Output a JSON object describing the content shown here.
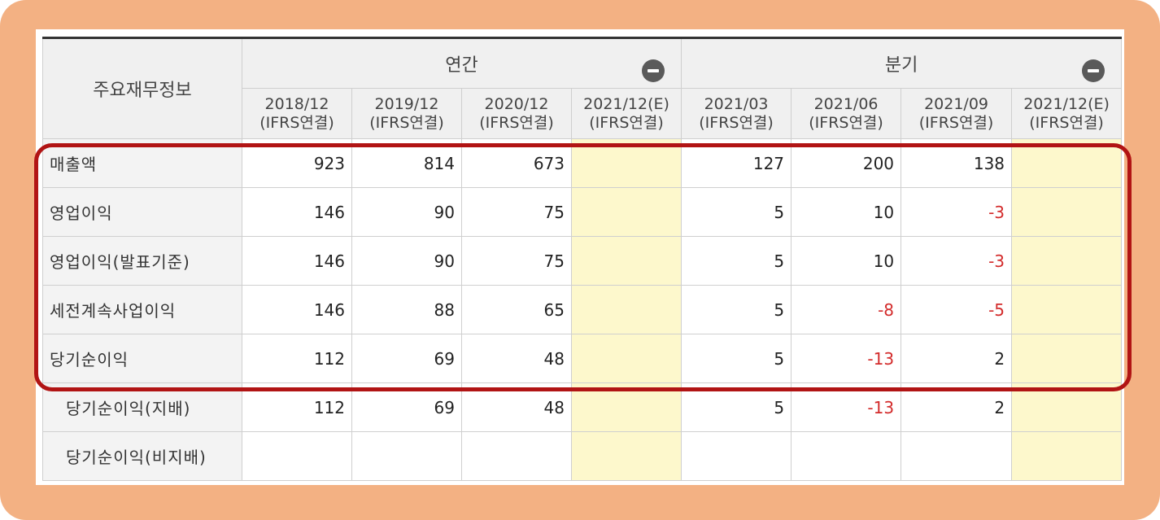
{
  "table": {
    "corner_label": "주요재무정보",
    "groups": [
      {
        "label": "연간",
        "toggle_icon": "minus-circle-icon"
      },
      {
        "label": "분기",
        "toggle_icon": "minus-circle-icon"
      }
    ],
    "periods": [
      {
        "date": "2018/12",
        "basis": "(IFRS연결)"
      },
      {
        "date": "2019/12",
        "basis": "(IFRS연결)"
      },
      {
        "date": "2020/12",
        "basis": "(IFRS연결)"
      },
      {
        "date": "2021/12(E)",
        "basis": "(IFRS연결)"
      },
      {
        "date": "2021/03",
        "basis": "(IFRS연결)"
      },
      {
        "date": "2021/06",
        "basis": "(IFRS연결)"
      },
      {
        "date": "2021/09",
        "basis": "(IFRS연결)"
      },
      {
        "date": "2021/12(E)",
        "basis": "(IFRS연결)"
      }
    ],
    "rows": [
      {
        "label": "매출액",
        "values": [
          "923",
          "814",
          "673",
          "",
          "127",
          "200",
          "138",
          ""
        ]
      },
      {
        "label": "영업이익",
        "values": [
          "146",
          "90",
          "75",
          "",
          "5",
          "10",
          "-3",
          ""
        ]
      },
      {
        "label": "영업이익(발표기준)",
        "values": [
          "146",
          "90",
          "75",
          "",
          "5",
          "10",
          "-3",
          ""
        ]
      },
      {
        "label": "세전계속사업이익",
        "values": [
          "146",
          "88",
          "65",
          "",
          "5",
          "-8",
          "-5",
          ""
        ]
      },
      {
        "label": "당기순이익",
        "values": [
          "112",
          "69",
          "48",
          "",
          "5",
          "-13",
          "2",
          ""
        ]
      },
      {
        "label": "당기순이익(지배)",
        "values": [
          "112",
          "69",
          "48",
          "",
          "5",
          "-13",
          "2",
          ""
        ]
      },
      {
        "label": "당기순이익(비지배)",
        "values": [
          "",
          "",
          "",
          "",
          "",
          "",
          "",
          ""
        ]
      }
    ]
  },
  "colors": {
    "frame": "#f3b183",
    "estimate_cell": "#fdf8cc",
    "negative_value": "#d32b2b",
    "highlight_border": "#b11414"
  }
}
